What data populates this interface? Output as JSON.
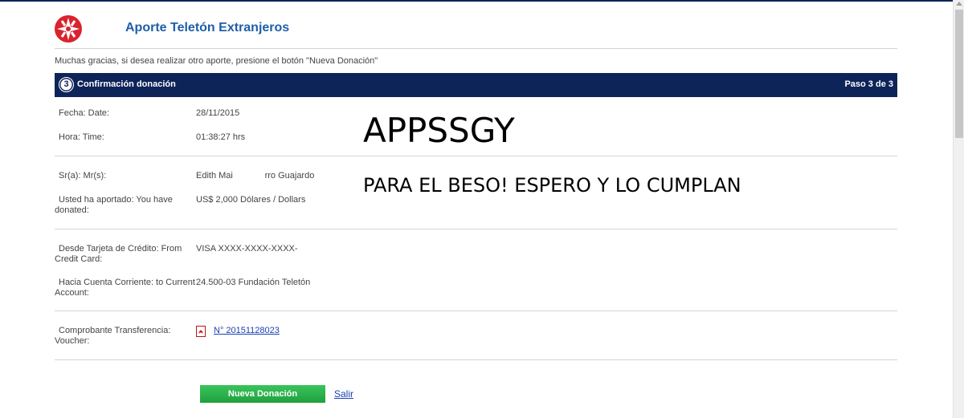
{
  "header": {
    "title": "Aporte Teletón Extranjeros",
    "logo_icon": "teleton-cross-logo-icon"
  },
  "message": "Muchas gracias, si desea realizar otro aporte, presione el botón \"Nueva Donación\"",
  "step_bar": {
    "number": "3",
    "title": "Confirmación donación",
    "step_count": "Paso 3 de 3"
  },
  "details": {
    "date_label": "Fecha: Date:",
    "date_value": "28/11/2015",
    "time_label": "Hora: Time:",
    "time_value": "01:38:27 hrs",
    "name_label": "Sr(a): Mr(s):",
    "name_value": "Edith Mai             rro Guajardo",
    "donated_label_1": "Usted ha aportado: You have",
    "donated_label_2": "donated:",
    "donated_value": "US$ 2,000 Dólares / Dollars",
    "card_label_1": "Desde Tarjeta de Crédito: From",
    "card_label_2": "Credit Card:",
    "card_value": "VISA XXXX-XXXX-XXXX-",
    "account_label_1": "Hacia Cuenta Corriente: to Current",
    "account_label_2": "Account:",
    "account_value": "24.500-03 Fundación Teletón",
    "voucher_label_1": "Comprobante Transferencia:",
    "voucher_label_2": "Voucher:",
    "voucher_link": "N° 20151128023",
    "voucher_icon": "pdf-icon"
  },
  "overlay": {
    "line1": "APPSSGY",
    "line2": "PARA EL BESO! ESPERO Y LO CUMPLAN"
  },
  "actions": {
    "new_donation_label": "Nueva Donación",
    "exit_label": "Salir"
  },
  "colors": {
    "navy": "#0d2459",
    "title_blue": "#1f5fa8",
    "button_green": "#22a843",
    "logo_red": "#d9232e"
  }
}
